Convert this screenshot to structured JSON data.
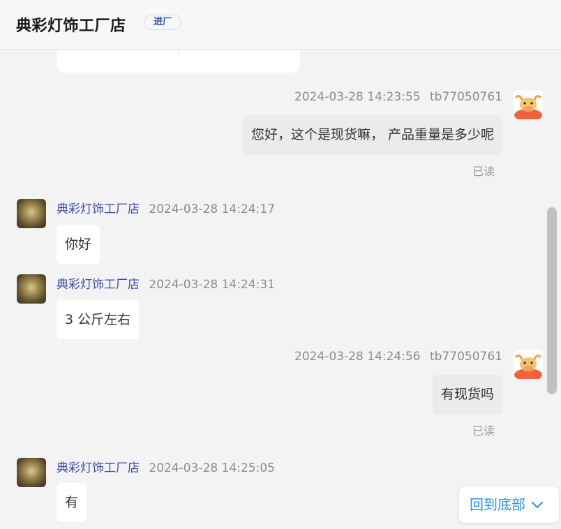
{
  "header": {
    "shop_name": "典彩灯饰工厂店",
    "badge": "进厂"
  },
  "messages": [
    {
      "side": "right",
      "timestamp": "2024-03-28 14:23:55",
      "user": "tb77050761",
      "text": "您好，这个是现货嘛， 产品重量是多少呢",
      "status": "已读"
    },
    {
      "side": "left",
      "sender": "典彩灯饰工厂店",
      "timestamp": "2024-03-28 14:24:17",
      "text": "你好"
    },
    {
      "side": "left",
      "sender": "典彩灯饰工厂店",
      "timestamp": "2024-03-28 14:24:31",
      "text": "3 公斤左右"
    },
    {
      "side": "right",
      "timestamp": "2024-03-28 14:24:56",
      "user": "tb77050761",
      "text": "有现货吗",
      "status": "已读"
    },
    {
      "side": "left",
      "sender": "典彩灯饰工厂店",
      "timestamp": "2024-03-28 14:25:05",
      "text": "有"
    }
  ],
  "back_to_bottom": "回到底部",
  "icons": {
    "shop_avatar": "chandelier-avatar-icon",
    "user_avatar": "cartoon-ox-avatar-icon",
    "scroll_down": "chevron-down-icon"
  },
  "colors": {
    "accent": "#2b8ff2",
    "sender_name": "#3a4bb0",
    "badge_text": "#2f5aa3"
  }
}
